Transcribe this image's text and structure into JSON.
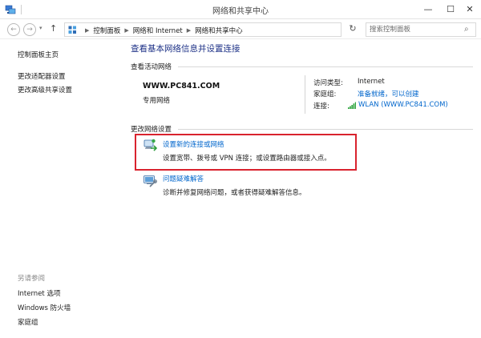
{
  "window": {
    "title": "网络和共享中心"
  },
  "addressbar": {
    "crumbs": [
      "控制面板",
      "网络和 Internet",
      "网络和共享中心"
    ],
    "search_placeholder": "搜索控制面板"
  },
  "sidebar": {
    "home": "控制面板主页",
    "links": [
      "更改适配器设置",
      "更改高级共享设置"
    ],
    "see_also_title": "另请参阅",
    "see_also": [
      "Internet 选项",
      "Windows 防火墙",
      "家庭组"
    ]
  },
  "main": {
    "title": "查看基本网络信息并设置连接",
    "active_networks_label": "查看活动网络",
    "network": {
      "name": "WWW.PC841.COM",
      "type": "专用网络",
      "access_type_key": "访问类型:",
      "access_type_value": "Internet",
      "homegroup_key": "家庭组:",
      "homegroup_value": "准备就绪，可以创建",
      "connection_key": "连接:",
      "connection_value": "WLAN (WWW.PC841.COM)"
    },
    "change_settings_label": "更改网络设置",
    "tasks": [
      {
        "link": "设置新的连接或网络",
        "description": "设置宽带、拨号或 VPN 连接；或设置路由器或接入点。"
      },
      {
        "link": "问题疑难解答",
        "description": "诊断并修复网络问题，或者获得疑难解答信息。"
      }
    ]
  },
  "colors": {
    "link": "#0066cc",
    "title": "#1e3287",
    "highlight": "#d9232e"
  }
}
